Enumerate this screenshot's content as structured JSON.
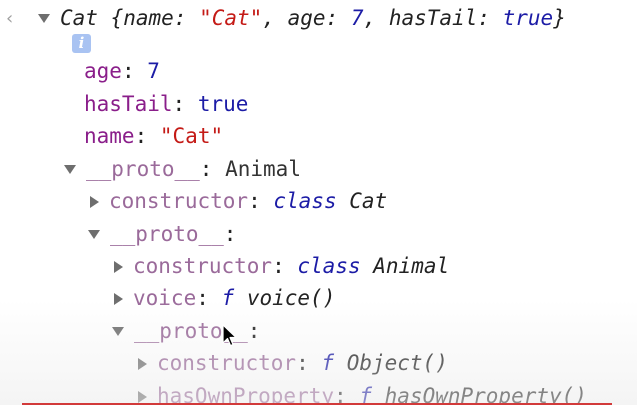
{
  "console": {
    "prompt_chevron": "‹",
    "summary": {
      "class_name": "Cat",
      "open_brace": " {",
      "k1": "name",
      "v1": "\"Cat\"",
      "k2": "age",
      "v2": "7",
      "k3": "hasTail",
      "v3": "true",
      "close_brace": "}"
    },
    "info_badge": "i",
    "props": [
      {
        "key": "age",
        "value": "7"
      },
      {
        "key": "hasTail",
        "value": "true"
      },
      {
        "key": "name",
        "value": "\"Cat\""
      }
    ],
    "proto1": {
      "key": "__proto__",
      "value": "Animal"
    },
    "proto1_constructor": {
      "key": "constructor",
      "kw": "class",
      "value": "Cat"
    },
    "proto2": {
      "key": "__proto__"
    },
    "proto2_constructor": {
      "key": "constructor",
      "kw": "class",
      "value": "Animal"
    },
    "proto2_voice": {
      "key": "voice",
      "kw": "f",
      "value": "voice()"
    },
    "proto3": {
      "key": "__proto__"
    },
    "proto3_constructor": {
      "key": "constructor",
      "kw": "f",
      "value": "Object()"
    },
    "proto3_hasown": {
      "key": "hasOwnProperty",
      "kw": "f",
      "value": "hasOwnProperty()"
    },
    "colon": ":"
  },
  "colors": {
    "key": "#8a1e8a",
    "proto_key": "#9a6a9a",
    "number": "#1c1ca6",
    "string": "#c41a16"
  }
}
